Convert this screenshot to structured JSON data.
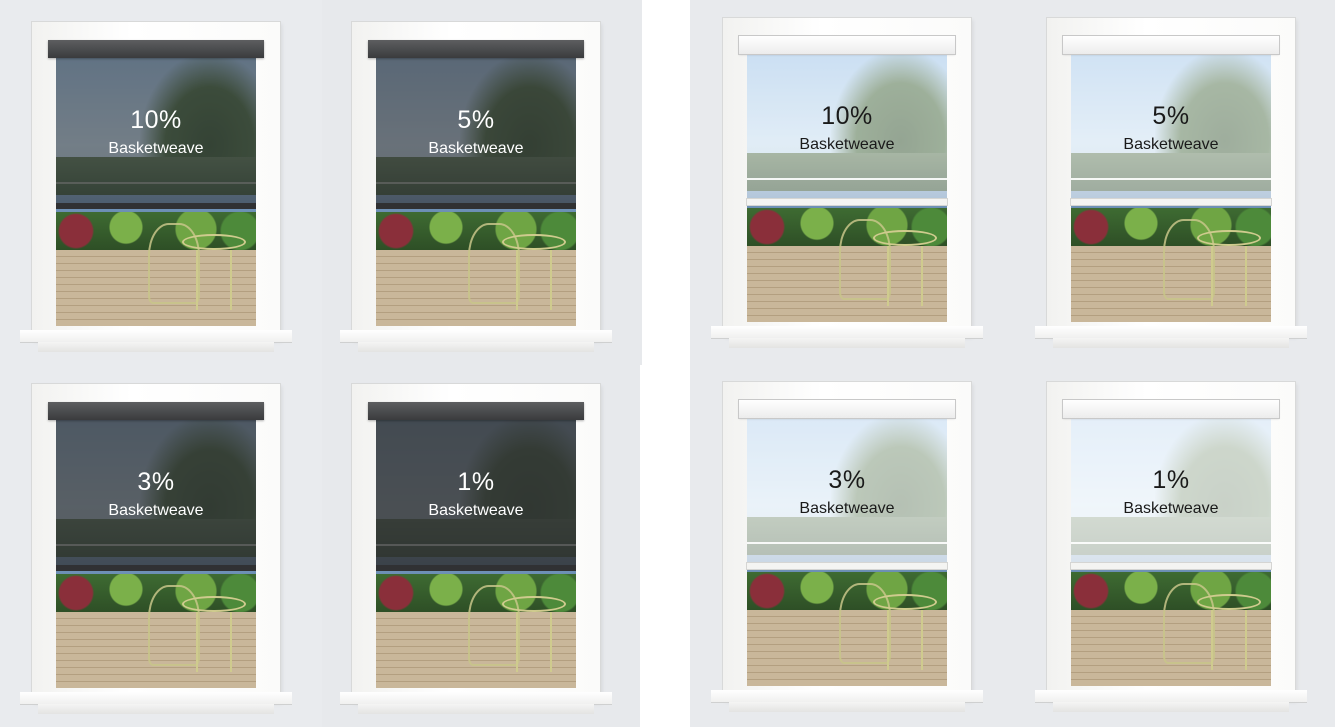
{
  "colors": {
    "dark_shade": "#2e2f31",
    "light_shade": "#ffffff",
    "background": "#e9ebee"
  },
  "samples": [
    {
      "percent": "10%",
      "name": "Basketweave",
      "color": "dark",
      "opacity": 0.55
    },
    {
      "percent": "5%",
      "name": "Basketweave",
      "color": "dark",
      "opacity": 0.62
    },
    {
      "percent": "3%",
      "name": "Basketweave",
      "color": "dark",
      "opacity": 0.72
    },
    {
      "percent": "1%",
      "name": "Basketweave",
      "color": "dark",
      "opacity": 0.82
    },
    {
      "percent": "10%",
      "name": "Basketweave",
      "color": "light",
      "opacity": 0.45
    },
    {
      "percent": "5%",
      "name": "Basketweave",
      "color": "light",
      "opacity": 0.5
    },
    {
      "percent": "3%",
      "name": "Basketweave",
      "color": "light",
      "opacity": 0.62
    },
    {
      "percent": "1%",
      "name": "Basketweave",
      "color": "light",
      "opacity": 0.72
    }
  ]
}
